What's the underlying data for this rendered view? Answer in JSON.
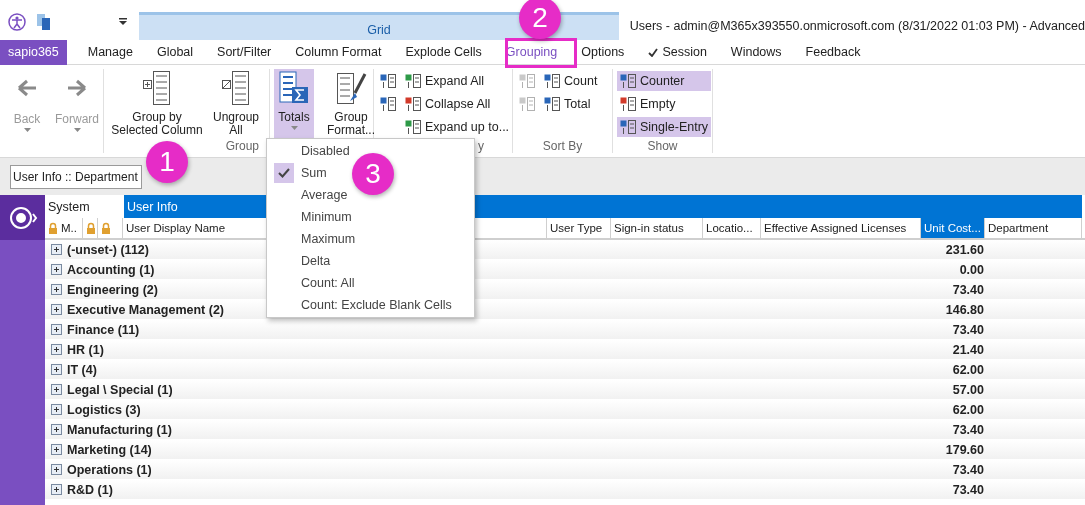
{
  "title_bar": {
    "context_tab": "Grid",
    "title": "Users - admin@M365x393550.onmicrosoft.com (8/31/2022 01:03 PM) - Advanced"
  },
  "tabs": [
    {
      "label": "sapio365",
      "kind": "app",
      "selected": false
    },
    {
      "label": "Manage",
      "kind": "tab",
      "selected": false
    },
    {
      "label": "Global",
      "kind": "tab",
      "selected": false
    },
    {
      "label": "Sort/Filter",
      "kind": "tab",
      "selected": false
    },
    {
      "label": "Column Format",
      "kind": "tab",
      "selected": false
    },
    {
      "label": "Explode Cells",
      "kind": "tab",
      "selected": false
    },
    {
      "label": "Grouping",
      "kind": "tab",
      "selected": true
    },
    {
      "label": "Options",
      "kind": "tab",
      "selected": false
    },
    {
      "label": "Session",
      "kind": "checked",
      "selected": false
    },
    {
      "label": "Windows",
      "kind": "tab",
      "selected": false
    },
    {
      "label": "Feedback",
      "kind": "tab",
      "selected": false
    }
  ],
  "ribbon": [
    {
      "buttons": [
        {
          "label": "Back",
          "kind": "nav",
          "disabled": true,
          "selected": false
        },
        {
          "label": "Forward",
          "kind": "nav",
          "disabled": true,
          "selected": false
        }
      ]
    },
    {
      "label": "Group",
      "buttons": [
        {
          "label": "Group by Selected Column",
          "kind": "large",
          "disabled": false,
          "selected": false
        },
        {
          "label": "Ungroup All",
          "kind": "large",
          "disabled": false,
          "selected": false
        }
      ]
    },
    {
      "buttons": [
        {
          "label": "Totals",
          "kind": "menu",
          "disabled": false,
          "selected": true
        },
        {
          "label": "Group Format...",
          "kind": "large",
          "disabled": false,
          "selected": false
        }
      ]
    },
    {
      "label": "y",
      "buttons": [
        {
          "kind": "icon",
          "disabled": false,
          "selected": false
        },
        {
          "kind": "icon",
          "disabled": false,
          "selected": false
        },
        {
          "label": "Expand All",
          "kind": "small",
          "disabled": false,
          "selected": false
        },
        {
          "label": "Collapse All",
          "kind": "small",
          "disabled": false,
          "selected": false
        },
        {
          "label": "Expand up to...",
          "kind": "small",
          "disabled": false,
          "selected": false
        }
      ]
    },
    {
      "label": "Sort By",
      "buttons": [
        {
          "kind": "icon",
          "disabled": true,
          "selected": false
        },
        {
          "kind": "icon",
          "disabled": true,
          "selected": false
        },
        {
          "label": "Count",
          "kind": "small",
          "disabled": false,
          "selected": false
        },
        {
          "label": "Total",
          "kind": "small",
          "disabled": false,
          "selected": false
        }
      ]
    },
    {
      "label": "Show",
      "buttons": [
        {
          "label": "Counter",
          "kind": "small",
          "disabled": false,
          "selected": true
        },
        {
          "label": "Empty",
          "kind": "small",
          "disabled": false,
          "selected": false
        },
        {
          "label": "Single-Entry",
          "kind": "small",
          "disabled": false,
          "selected": true
        }
      ]
    }
  ],
  "group_field": {
    "value": "User Info :: Department"
  },
  "grid": {
    "bands": [
      {
        "label": "System",
        "selected": false
      },
      {
        "label": "User Info",
        "selected": true
      }
    ],
    "columns": [
      {
        "label": "M..",
        "kind": "lock",
        "selected": false
      },
      {
        "kind": "lock",
        "selected": false
      },
      {
        "kind": "lock",
        "selected": false
      },
      {
        "label": "User Display Name",
        "kind": "text",
        "selected": false
      },
      {
        "label": "User Type",
        "kind": "text",
        "selected": false
      },
      {
        "label": "Sign-in status",
        "kind": "text",
        "selected": false
      },
      {
        "label": "Locatio...",
        "kind": "text",
        "selected": false
      },
      {
        "label": "Effective Assigned Licenses",
        "kind": "text",
        "selected": false
      },
      {
        "label": "Unit Cost...",
        "kind": "text",
        "selected": true
      },
      {
        "label": "Department",
        "kind": "text",
        "selected": false
      }
    ],
    "rows": [
      {
        "label": "(-unset-) (112)",
        "unit_cost": "231.60"
      },
      {
        "label": "Accounting (1)",
        "unit_cost": "0.00"
      },
      {
        "label": "Engineering (2)",
        "unit_cost": "73.40"
      },
      {
        "label": "Executive Management (2)",
        "unit_cost": "146.80"
      },
      {
        "label": "Finance (11)",
        "unit_cost": "73.40"
      },
      {
        "label": "HR (1)",
        "unit_cost": "21.40"
      },
      {
        "label": "IT (4)",
        "unit_cost": "62.00"
      },
      {
        "label": "Legal \\ Special (1)",
        "unit_cost": "57.00"
      },
      {
        "label": "Logistics (3)",
        "unit_cost": "62.00"
      },
      {
        "label": "Manufacturing (1)",
        "unit_cost": "73.40"
      },
      {
        "label": "Marketing (14)",
        "unit_cost": "179.60"
      },
      {
        "label": "Operations (1)",
        "unit_cost": "73.40"
      },
      {
        "label": "R&D (1)",
        "unit_cost": "73.40"
      }
    ]
  },
  "totals_menu": [
    {
      "label": "Disabled",
      "checked": false
    },
    {
      "label": "Sum",
      "checked": true
    },
    {
      "label": "Average",
      "checked": false
    },
    {
      "label": "Minimum",
      "checked": false
    },
    {
      "label": "Maximum",
      "checked": false
    },
    {
      "label": "Delta",
      "checked": false
    },
    {
      "label": "Count: All",
      "checked": false
    },
    {
      "label": "Count: Exclude Blank Cells",
      "checked": false
    }
  ],
  "callouts": [
    {
      "label": "1"
    },
    {
      "label": "2"
    },
    {
      "label": "3"
    }
  ]
}
